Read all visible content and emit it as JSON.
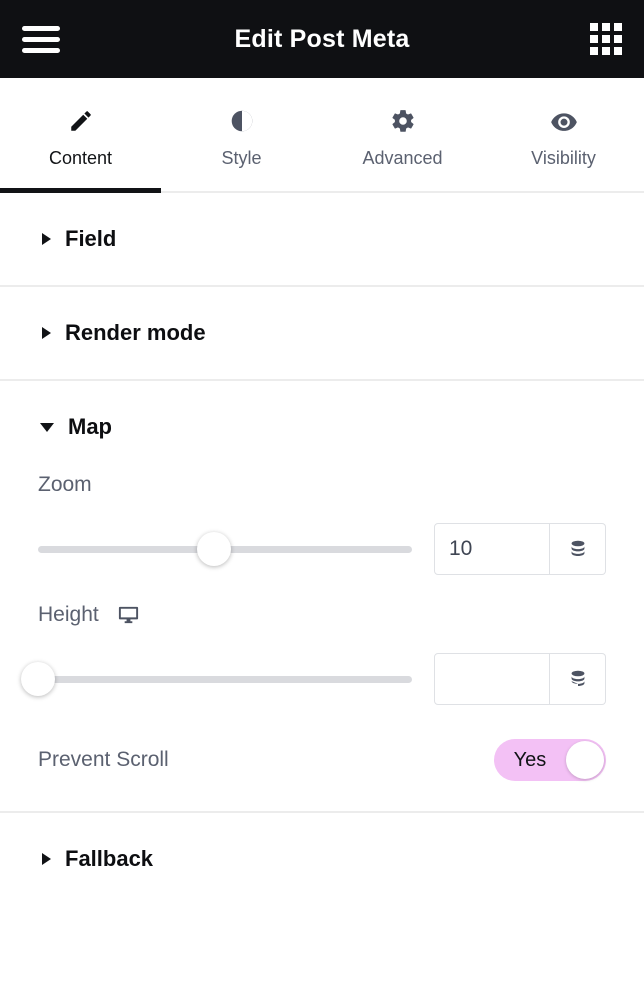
{
  "topbar": {
    "menu_icon": "hamburger-menu-icon",
    "title": "Edit Post Meta",
    "apps_icon": "grid-apps-icon"
  },
  "tabs": [
    {
      "label": "Content",
      "icon": "pencil-icon",
      "active": true
    },
    {
      "label": "Style",
      "icon": "contrast-icon",
      "active": false
    },
    {
      "label": "Advanced",
      "icon": "gear-icon",
      "active": false
    },
    {
      "label": "Visibility",
      "icon": "eye-icon",
      "active": false
    }
  ],
  "sections": [
    {
      "title": "Field",
      "expanded": false
    },
    {
      "title": "Render mode",
      "expanded": false
    },
    {
      "title": "Map",
      "expanded": true
    },
    {
      "title": "Fallback",
      "expanded": false
    }
  ],
  "map_section": {
    "zoom": {
      "label": "Zoom",
      "value": "10",
      "placeholder": "",
      "slider_percent": 47,
      "dynamic_icon": "database-stack-icon"
    },
    "height": {
      "label": "Height",
      "device_icon": "desktop-monitor-icon",
      "value": "",
      "placeholder": "",
      "slider_percent": 0,
      "dynamic_icon": "database-stack-icon"
    },
    "prevent_scroll": {
      "label": "Prevent Scroll",
      "toggle_value": "Yes",
      "toggle_on": true
    }
  },
  "colors": {
    "topbar_bg": "#0f1013",
    "accent_toggle": "#f3c1f5",
    "active_tab": "#111316",
    "label_text": "#5b6170",
    "track": "#d9dade",
    "divider": "#ececec"
  }
}
